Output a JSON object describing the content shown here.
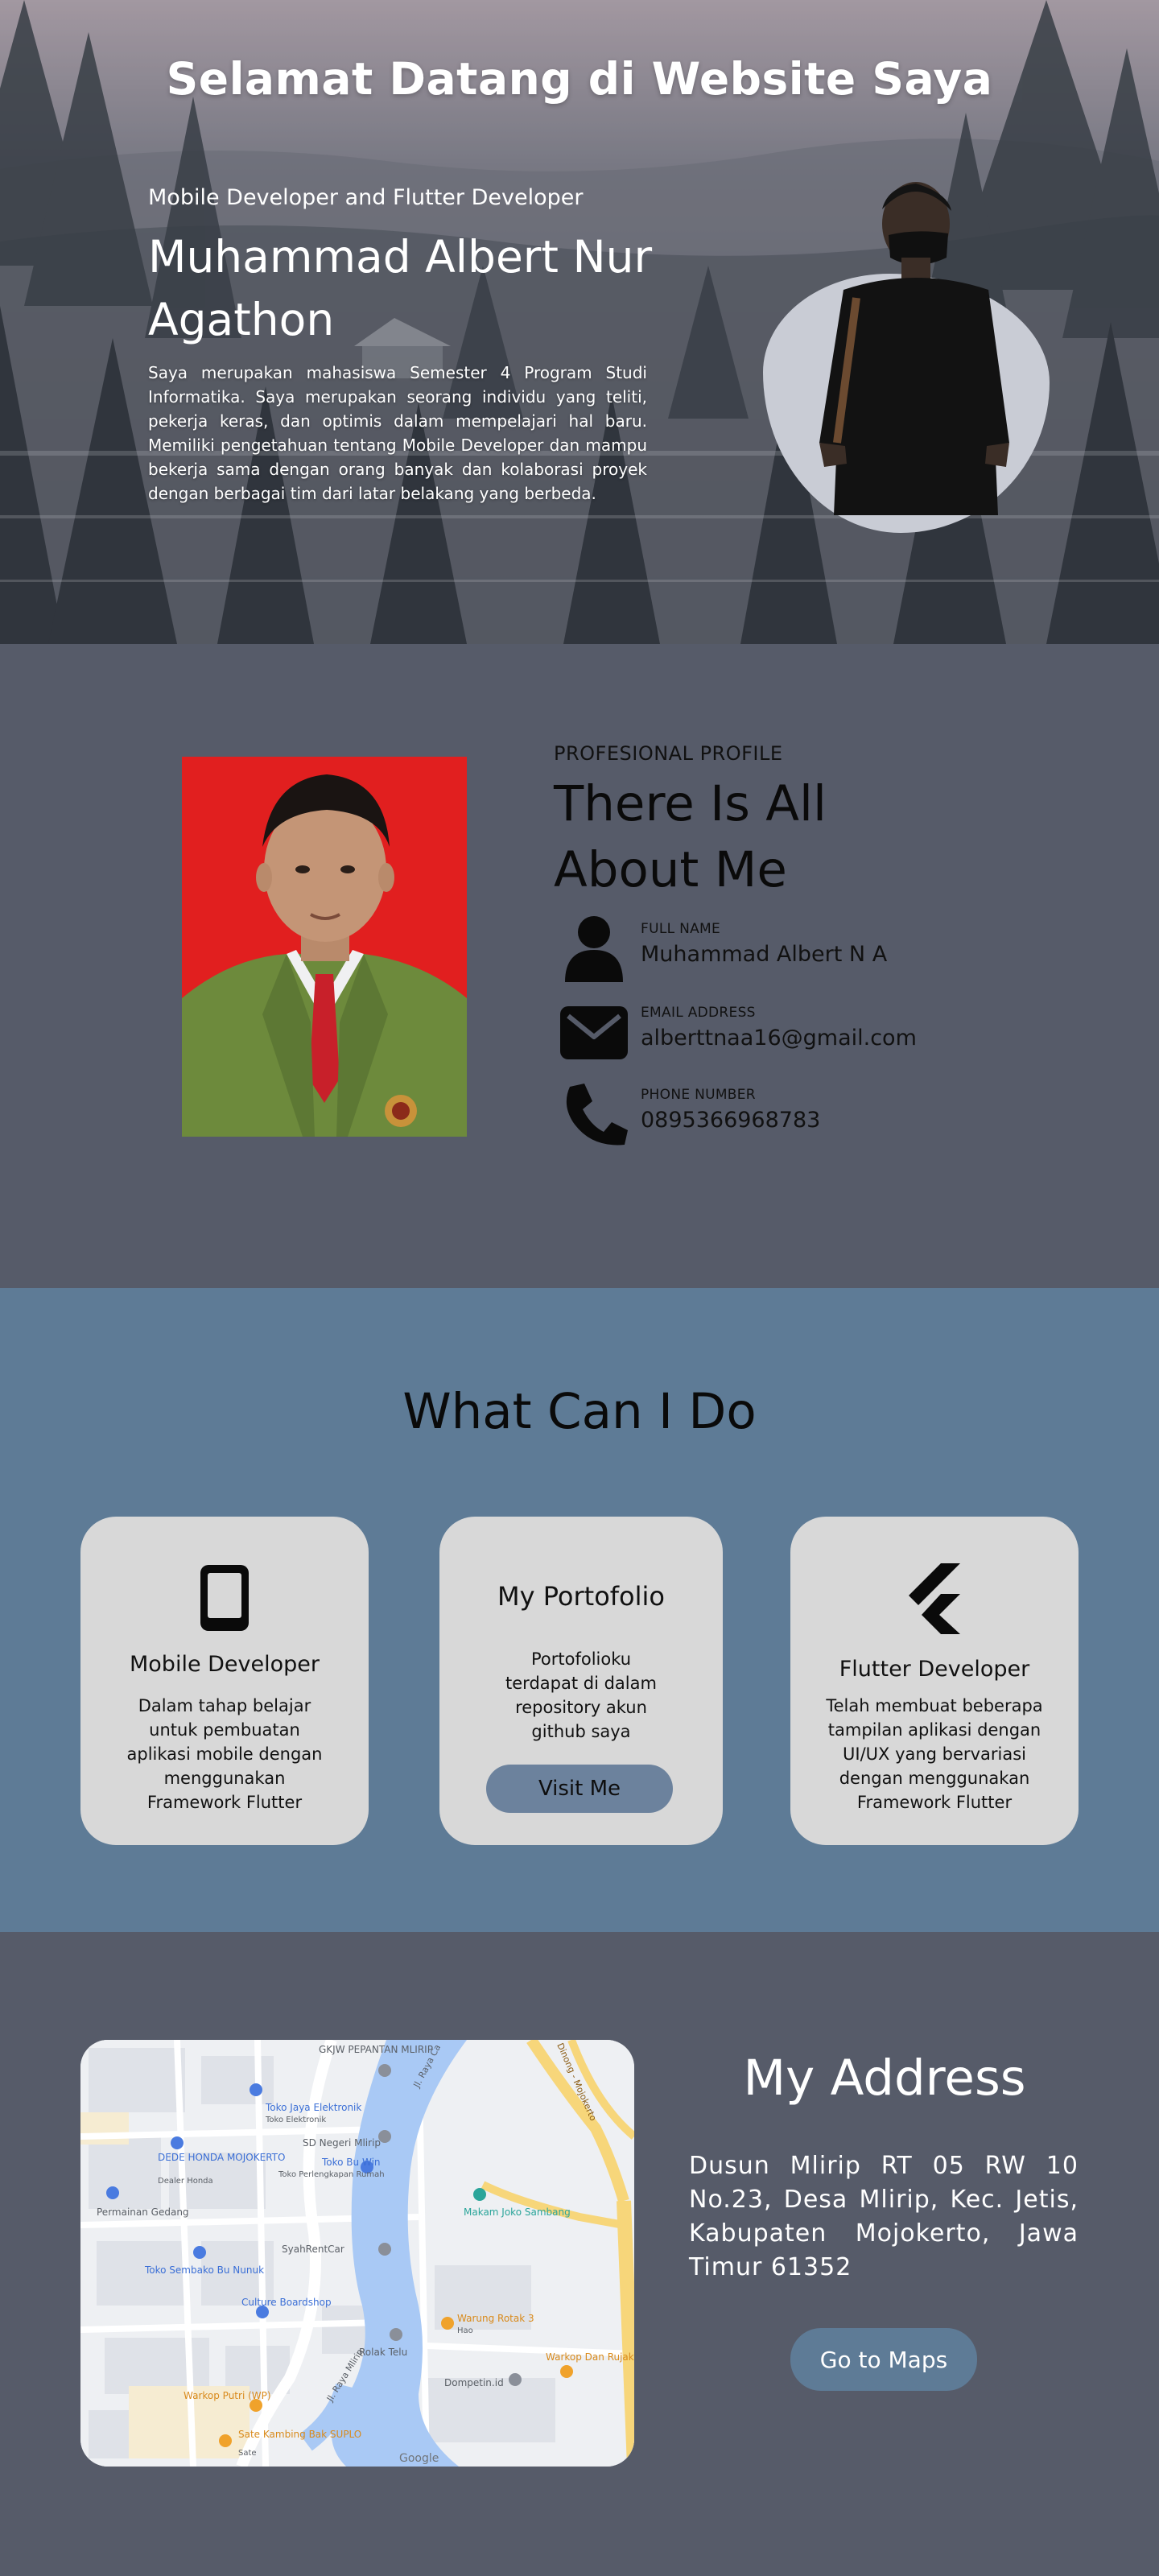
{
  "hero": {
    "title": "Selamat Datang di Website Saya",
    "role": "Mobile Developer and Flutter Developer",
    "name": "Muhammad Albert Nur Agathon",
    "description": "Saya merupakan mahasiswa Semester 4 Program Studi Informatika. Saya merupakan seorang individu yang teliti, pekerja keras, dan optimis dalam mempelajari hal baru. Memiliki pengetahuan tentang Mobile Developer dan mampu bekerja sama dengan orang banyak dan kolaborasi proyek dengan berbagai tim dari latar belakang yang berbeda."
  },
  "profile": {
    "kicker": "PROFESIONAL PROFILE",
    "title": "There Is All About Me",
    "items": [
      {
        "label": "FULL NAME",
        "value": "Muhammad Albert N A",
        "icon": "person-icon"
      },
      {
        "label": "EMAIL ADDRESS",
        "value": "alberttnaa16@gmail.com",
        "icon": "mail-icon"
      },
      {
        "label": "PHONE NUMBER",
        "value": "0895366968783",
        "icon": "phone-icon"
      }
    ]
  },
  "services": {
    "title": "What Can I Do",
    "cards": [
      {
        "title": "Mobile Developer",
        "text": "Dalam tahap belajar untuk pembuatan aplikasi mobile dengan menggunakan Framework Flutter",
        "icon": "mobile-phone-icon"
      },
      {
        "title": "My Portofolio",
        "text": "Portofolioku terdapat di dalam repository akun github saya",
        "button": "Visit Me"
      },
      {
        "title": "Flutter Developer",
        "text": "Telah membuat beberapa tampilan aplikasi dengan UI/UX yang bervariasi dengan menggunakan Framework Flutter",
        "icon": "flutter-icon"
      }
    ]
  },
  "address": {
    "title": "My Address",
    "text": "Dusun Mlirip RT 05 RW 10 No.23, Desa Mlirip, Kec. Jetis, Kabupaten Mojokerto, Jawa Timur 61352",
    "button": "Go to Maps",
    "map_labels": {
      "pepantan": "GKJW PEPANTAN MLIRIP",
      "jaya": "Toko Jaya Elektronik",
      "jaya_sub": "Toko Elektronik",
      "sdn": "SD Negeri Mlirip",
      "dede": "DEDE HONDA MOJOKERTO",
      "dede_sub": "Dealer Honda",
      "buwin": "Toko Bu Win",
      "buwin_sub": "Toko Perlengkapan Rumah",
      "permainan": "Permainan Gedang",
      "makam": "Makam Joko Sambang",
      "syah": "SyahRentCar",
      "sembako": "Toko Sembako Bu Nunuk",
      "culture": "Culture Boardshop",
      "rotak": "Warung Rotak 3",
      "rotak_sub": "Hao",
      "rolak": "Rolak Telu",
      "kopi": "Warkop Dan Rujak Cingur Yuk Ai",
      "dompetin": "Dompetin.id",
      "putri": "Warkop Putri (WP)",
      "kambing": "Sate Kambing Bak SUPLO",
      "kambing_sub": "Sate",
      "road1": "Jl. Raya Ca",
      "road2": "Jl. Raya Mlirip",
      "road3": "Dinong - Mojokerto",
      "google": "Google"
    }
  },
  "colors": {
    "profile_bg": "#565b69",
    "services_bg": "#5e7b96",
    "card_bg": "#d8d8d8",
    "visit_button": "#6c829d",
    "maps_button": "#5e7b96"
  }
}
